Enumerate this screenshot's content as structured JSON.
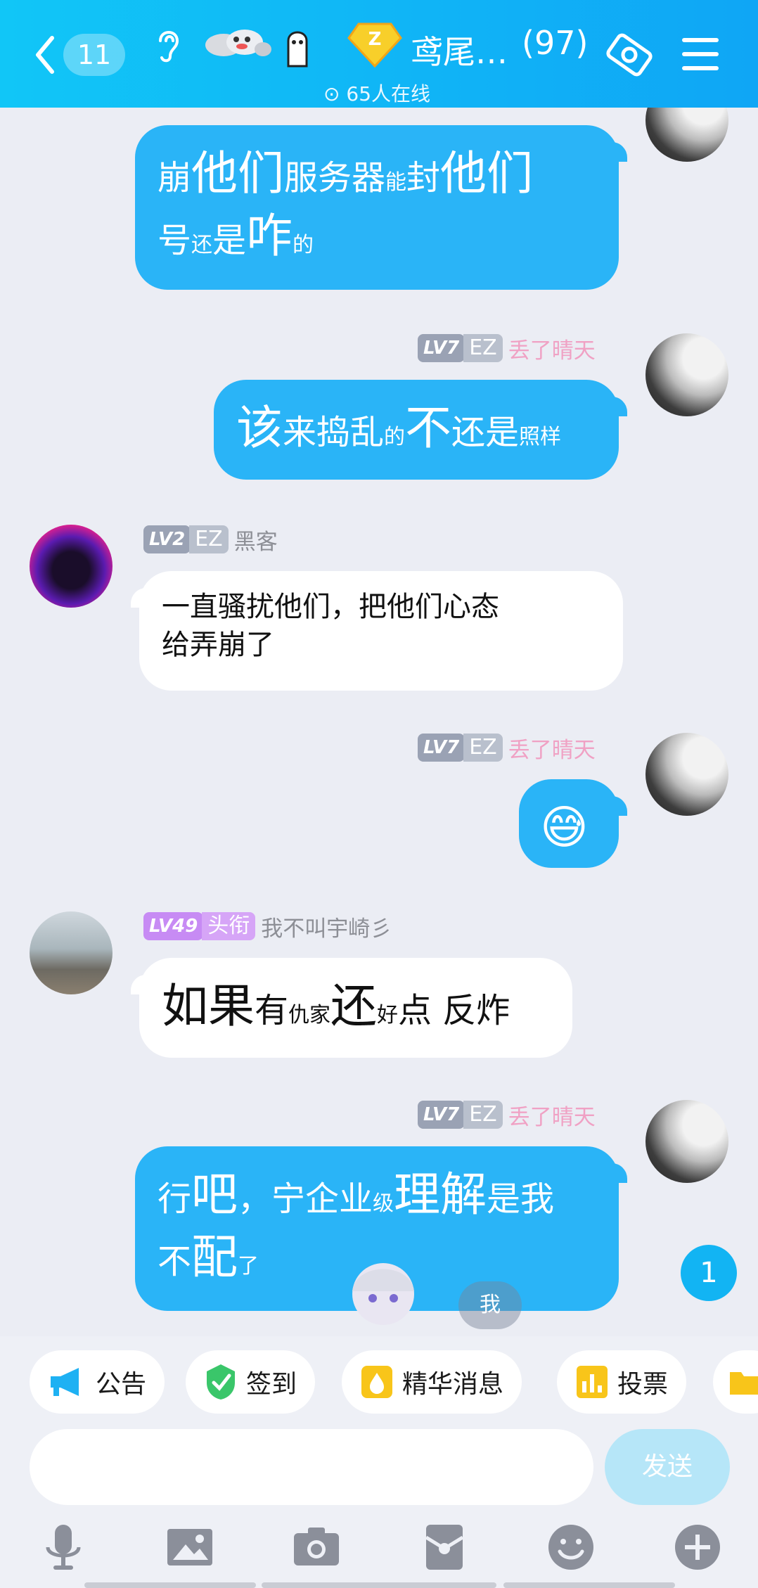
{
  "header": {
    "unread_count": "11",
    "group_title": "鸢尾…",
    "member_count": "(97)",
    "online_status": "65人在线"
  },
  "messages": [
    {
      "sender": "me",
      "bubble": "tail-of-prev",
      "segments": [
        {
          "t": "崩",
          "s": "mid"
        },
        {
          "t": "他们",
          "s": "big"
        },
        {
          "t": "服务器",
          "s": "mid"
        },
        {
          "t": "能",
          "s": "sm"
        },
        {
          "t": "封",
          "s": "mid"
        },
        {
          "t": "他们",
          "s": "big"
        },
        {
          "t": "\n"
        },
        {
          "t": "号",
          "s": "mid"
        },
        {
          "t": "还",
          "s": "sm"
        },
        {
          "t": "是",
          "s": "mid"
        },
        {
          "t": "咋",
          "s": "big"
        },
        {
          "t": "的",
          "s": "sm"
        }
      ]
    },
    {
      "sender": "me",
      "level": "LV7",
      "tag": "EZ",
      "nickname": "丢了晴天",
      "segments": [
        {
          "t": "该",
          "s": "big"
        },
        {
          "t": "来捣乱",
          "s": "mid"
        },
        {
          "t": "的",
          "s": "sm"
        },
        {
          "t": "不",
          "s": "big"
        },
        {
          "t": "还是",
          "s": "mid"
        },
        {
          "t": "照样",
          "s": "sm"
        }
      ]
    },
    {
      "sender": "other",
      "level": "LV2",
      "tag": "EZ",
      "nickname": "黑客",
      "segments": [
        {
          "t": "一直骚扰他们，把他们心态\n给弄崩了",
          "s": "normal"
        }
      ]
    },
    {
      "sender": "me",
      "level": "LV7",
      "tag": "EZ",
      "nickname": "丢了晴天",
      "segments": [
        {
          "t": "😅",
          "s": "emoji"
        }
      ]
    },
    {
      "sender": "other",
      "level": "LV49",
      "tag": "头衔",
      "nickname": "我不叫宇崎彡",
      "segments": [
        {
          "t": "如果",
          "s": "big"
        },
        {
          "t": "有",
          "s": "mid"
        },
        {
          "t": "仇家",
          "s": "sm"
        },
        {
          "t": "还",
          "s": "big"
        },
        {
          "t": "好",
          "s": "sm"
        },
        {
          "t": "点 反炸",
          "s": "mid"
        }
      ]
    },
    {
      "sender": "me",
      "level": "LV7",
      "tag": "EZ",
      "nickname": "丢了晴天",
      "segments": [
        {
          "t": "行",
          "s": "mid"
        },
        {
          "t": "吧",
          "s": "big"
        },
        {
          "t": "，宁企业",
          "s": "mid"
        },
        {
          "t": "级",
          "s": "sm"
        },
        {
          "t": "理解",
          "s": "big"
        },
        {
          "t": "是我",
          "s": "mid"
        },
        {
          "t": "\n"
        },
        {
          "t": "不",
          "s": "mid"
        },
        {
          "t": "配",
          "s": "big"
        },
        {
          "t": "了",
          "s": "sm"
        }
      ]
    }
  ],
  "floating": {
    "new_message_count": "1",
    "me_chip": "我"
  },
  "quick_actions": [
    {
      "label": "公告",
      "icon": "megaphone-icon"
    },
    {
      "label": "签到",
      "icon": "check-shield-icon"
    },
    {
      "label": "精华消息",
      "icon": "essence-icon"
    },
    {
      "label": "投票",
      "icon": "bar-chart-icon"
    }
  ],
  "composer": {
    "send_label": "发送",
    "input_value": ""
  },
  "toolbar": [
    "microphone-icon",
    "image-icon",
    "camera-icon",
    "red-packet-icon",
    "emoji-icon",
    "plus-icon"
  ],
  "colors": {
    "accent": "#12b4f3",
    "my_bubble": "#2ab4f7",
    "nick_pink": "#f0a1c4"
  }
}
